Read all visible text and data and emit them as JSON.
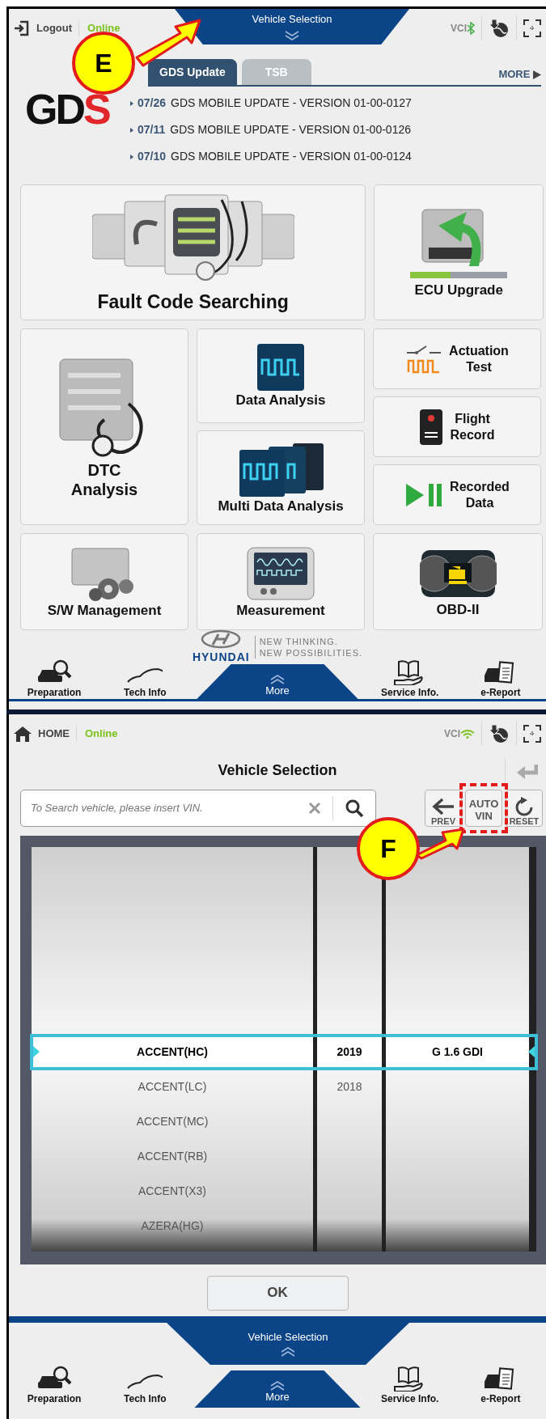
{
  "home": {
    "top_bar": {
      "button": "Logout",
      "status": "Online",
      "vci": "VCI",
      "center_tab": "Vehicle Selection"
    },
    "news_tabs": [
      {
        "label": "GDS Update",
        "selected": true
      },
      {
        "label": "TSB",
        "selected": false
      }
    ],
    "more_link": "MORE",
    "logo": "GDS",
    "news": [
      {
        "date": "07/26",
        "title": "GDS MOBILE UPDATE - VERSION 01-00-0127"
      },
      {
        "date": "07/11",
        "title": "GDS MOBILE UPDATE - VERSION 01-00-0126"
      },
      {
        "date": "07/10",
        "title": "GDS MOBILE UPDATE - VERSION 01-00-0124"
      }
    ],
    "tiles": [
      {
        "label": "Fault Code Searching",
        "kind": "wide"
      },
      {
        "label": "ECU Upgrade",
        "kind": "square"
      },
      {
        "label": "DTC Analysis",
        "kind": "tall"
      },
      {
        "label": "Data Analysis",
        "kind": "square"
      },
      {
        "label": "Multi Data Analysis",
        "kind": "square"
      },
      {
        "label": "Actuation Test",
        "kind": "compact"
      },
      {
        "label": "Flight Record",
        "kind": "compact"
      },
      {
        "label": "Recorded Data",
        "kind": "compact"
      },
      {
        "label": "S/W Management",
        "kind": "square"
      },
      {
        "label": "Measurement",
        "kind": "square"
      },
      {
        "label": "OBD-II",
        "kind": "square"
      }
    ],
    "brand": {
      "name": "HYUNDAI",
      "tagline": [
        "NEW THINKING.",
        "NEW POSSIBILITIES."
      ]
    },
    "bottom_nav": [
      {
        "label": "Preparation"
      },
      {
        "label": "Tech Info"
      },
      {
        "label": "More"
      },
      {
        "label": "Service Info."
      },
      {
        "label": "e-Report"
      }
    ],
    "annotation": "E"
  },
  "vehicle_selection": {
    "top_bar": {
      "button": "HOME",
      "status": "Online",
      "vci": "VCI"
    },
    "title": "Vehicle Selection",
    "search": {
      "placeholder": "To Search vehicle, please insert VIN."
    },
    "buttons": [
      {
        "label": "PREV"
      },
      {
        "label": "AUTO VIN",
        "highlighted": true
      },
      {
        "label": "RESET"
      }
    ],
    "rows": [
      {
        "model": "ACCENT(HC)",
        "year": "2019",
        "engine": "G 1.6 GDI",
        "selected": true
      },
      {
        "model": "ACCENT(LC)",
        "year": "2018",
        "selected": false
      },
      {
        "model": "ACCENT(MC)",
        "selected": false
      },
      {
        "model": "ACCENT(RB)",
        "selected": false
      },
      {
        "model": "ACCENT(X3)",
        "selected": false
      },
      {
        "model": "AZERA(HG)",
        "selected": false
      }
    ],
    "ok": "OK",
    "pull_tab": "Vehicle Selection",
    "bottom_nav": [
      {
        "label": "Preparation"
      },
      {
        "label": "Tech Info"
      },
      {
        "label": "More"
      },
      {
        "label": "Service Info."
      },
      {
        "label": "e-Report"
      }
    ],
    "annotation": "F"
  }
}
